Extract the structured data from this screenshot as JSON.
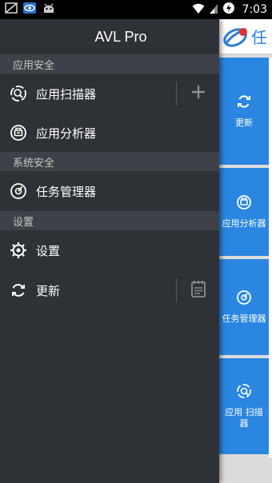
{
  "status_bar": {
    "time": "7:03"
  },
  "background_app": {
    "title": "任",
    "tiles": [
      {
        "label": "更新",
        "icon": "refresh-icon"
      },
      {
        "label": "应用分析器",
        "icon": "analyzer-icon"
      },
      {
        "label": "任务管理器",
        "icon": "task-manager-icon"
      },
      {
        "label": "应用 扫描器",
        "icon": "scanner-icon"
      }
    ]
  },
  "drawer": {
    "title": "AVL Pro",
    "sections": [
      {
        "header": "应用安全",
        "items": [
          {
            "label": "应用扫描器",
            "icon": "scanner-icon",
            "action_icon": "plus-icon"
          },
          {
            "label": "应用分析器",
            "icon": "analyzer-icon"
          }
        ]
      },
      {
        "header": "系统安全",
        "items": [
          {
            "label": "任务管理器",
            "icon": "task-manager-icon"
          }
        ]
      },
      {
        "header": "设置",
        "items": [
          {
            "label": "设置",
            "icon": "gear-icon"
          },
          {
            "label": "更新",
            "icon": "refresh-icon",
            "action_icon": "notepad-icon"
          }
        ]
      }
    ]
  },
  "colors": {
    "drawer_bg": "#2e3237",
    "section_bg": "#3e4248",
    "accent": "#2a86e0"
  }
}
